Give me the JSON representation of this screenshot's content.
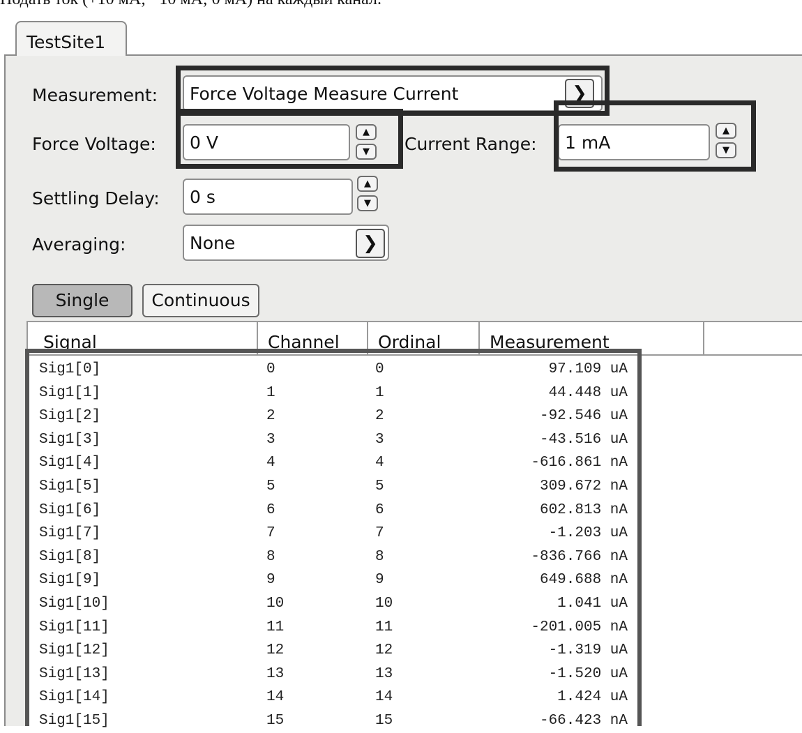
{
  "caption": "Подать ток (+10 мА; −10 мА; 0 мА) на каждый канал.",
  "tab": {
    "label": "TestSite1"
  },
  "form": {
    "measurement": {
      "label": "Measurement:",
      "value": "Force Voltage Measure Current"
    },
    "force_voltage": {
      "label": "Force Voltage:",
      "value": "0 V"
    },
    "current_range": {
      "label": "Current Range:",
      "value": "1 mA"
    },
    "settling_delay": {
      "label": "Settling Delay:",
      "value": "0 s"
    },
    "averaging": {
      "label": "Averaging:",
      "value": "None"
    }
  },
  "buttons": {
    "single": "Single",
    "continuous": "Continuous"
  },
  "table": {
    "columns": [
      "Signal",
      "Channel",
      "Ordinal",
      "Measurement"
    ],
    "rows": [
      {
        "signal": "Sig1[0]",
        "channel": "0",
        "ordinal": "0",
        "measurement": "97.109 uA"
      },
      {
        "signal": "Sig1[1]",
        "channel": "1",
        "ordinal": "1",
        "measurement": "44.448 uA"
      },
      {
        "signal": "Sig1[2]",
        "channel": "2",
        "ordinal": "2",
        "measurement": "-92.546 uA"
      },
      {
        "signal": "Sig1[3]",
        "channel": "3",
        "ordinal": "3",
        "measurement": "-43.516 uA"
      },
      {
        "signal": "Sig1[4]",
        "channel": "4",
        "ordinal": "4",
        "measurement": "-616.861 nA"
      },
      {
        "signal": "Sig1[5]",
        "channel": "5",
        "ordinal": "5",
        "measurement": "309.672 nA"
      },
      {
        "signal": "Sig1[6]",
        "channel": "6",
        "ordinal": "6",
        "measurement": "602.813 nA"
      },
      {
        "signal": "Sig1[7]",
        "channel": "7",
        "ordinal": "7",
        "measurement": "-1.203 uA"
      },
      {
        "signal": "Sig1[8]",
        "channel": "8",
        "ordinal": "8",
        "measurement": "-836.766 nA"
      },
      {
        "signal": "Sig1[9]",
        "channel": "9",
        "ordinal": "9",
        "measurement": "649.688 nA"
      },
      {
        "signal": "Sig1[10]",
        "channel": "10",
        "ordinal": "10",
        "measurement": "1.041 uA"
      },
      {
        "signal": "Sig1[11]",
        "channel": "11",
        "ordinal": "11",
        "measurement": "-201.005 nA"
      },
      {
        "signal": "Sig1[12]",
        "channel": "12",
        "ordinal": "12",
        "measurement": "-1.319 uA"
      },
      {
        "signal": "Sig1[13]",
        "channel": "13",
        "ordinal": "13",
        "measurement": "-1.520 uA"
      },
      {
        "signal": "Sig1[14]",
        "channel": "14",
        "ordinal": "14",
        "measurement": "1.424 uA"
      },
      {
        "signal": "Sig1[15]",
        "channel": "15",
        "ordinal": "15",
        "measurement": "-66.423 nA"
      }
    ]
  },
  "icons": {
    "dropdown": "chevron-down-icon",
    "spin_up": "chevron-up-icon",
    "spin_down": "chevron-down-icon"
  },
  "colors": {
    "highlight": "#2a2a2a",
    "panel": "#ececea"
  }
}
